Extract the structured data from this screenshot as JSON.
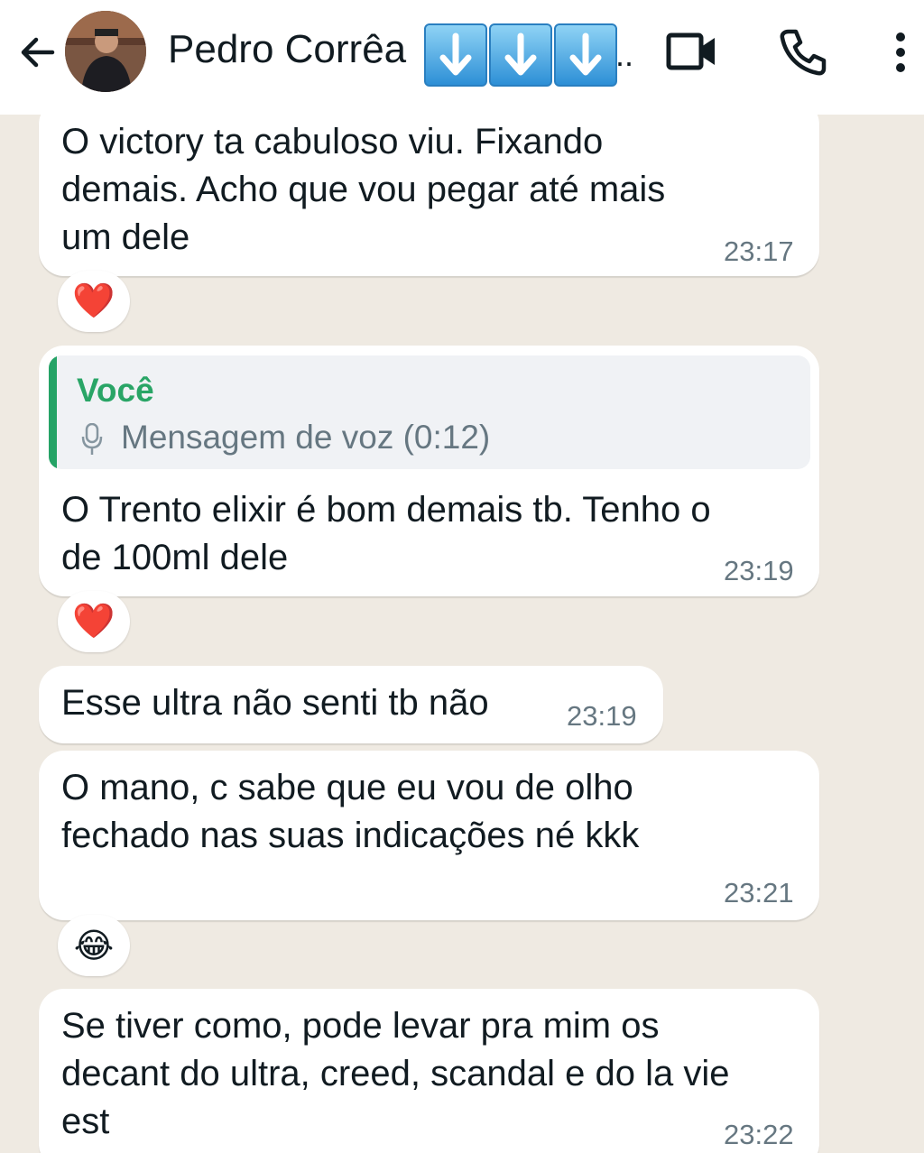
{
  "header": {
    "contact_name": "Pedro Corrêa",
    "name_emojis": [
      "down-arrow-key",
      "down-arrow-key",
      "down-arrow-key"
    ],
    "name_ellipsis": ".."
  },
  "messages": [
    {
      "id": "m1",
      "text": "O victory ta cabuloso viu. Fixando\ndemais. Acho que vou pegar até mais\num dele",
      "time": "23:17",
      "reaction": "❤️"
    },
    {
      "id": "m2",
      "quote": {
        "author": "Você",
        "icon": "microphone-icon",
        "text": "Mensagem de voz (0:12)"
      },
      "text": "O Trento elixir é bom demais tb. Tenho o\nde 100ml dele",
      "time": "23:19",
      "reaction": "❤️"
    },
    {
      "id": "m3",
      "text": "Esse ultra não senti tb não",
      "time": "23:19"
    },
    {
      "id": "m4",
      "text": "O mano, c sabe que eu vou de olho\nfechado nas suas indicações né kkk",
      "time": "23:21",
      "reaction": "😂"
    },
    {
      "id": "m5",
      "text": "Se tiver como, pode levar pra mim os\ndecant do ultra, creed, scandal e do la vie\nest",
      "time": "23:22"
    }
  ],
  "colors": {
    "chat_background": "#efeae2",
    "bubble": "#ffffff",
    "quote_accent": "#25a366",
    "timestamp": "#667781"
  }
}
